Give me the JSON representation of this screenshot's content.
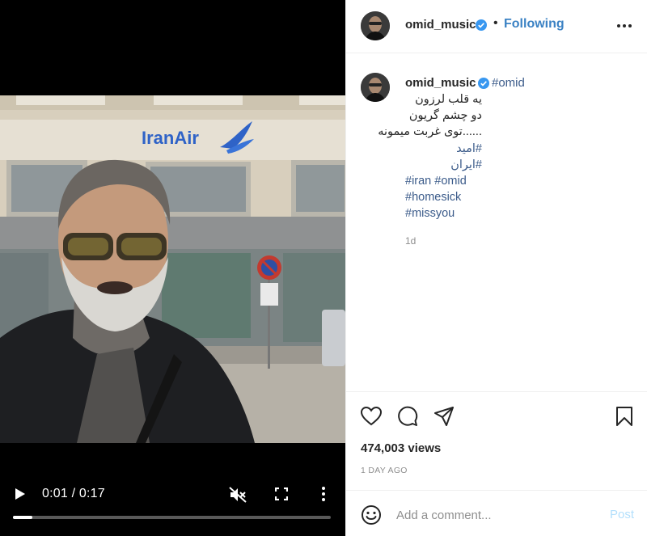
{
  "video": {
    "time_current": "0:01",
    "time_total": "0:17",
    "progress_fraction": 0.06,
    "sign_text": "IranAir"
  },
  "header": {
    "username": "omid_music",
    "separator": "•",
    "follow_status": "Following"
  },
  "caption": {
    "username": "omid_music",
    "first_tag": "#omid",
    "lines": [
      {
        "text": "یه قلب لرزون",
        "type": "rtl"
      },
      {
        "text": "دو چشم گریون",
        "type": "rtl"
      },
      {
        "text": "......توی غربت میمونه",
        "type": "rtl"
      },
      {
        "text": "#امید",
        "type": "rtl-tag"
      },
      {
        "text": "#ایران",
        "type": "rtl-tag"
      },
      {
        "text": "#iran #omid",
        "type": "tag"
      },
      {
        "text": "#homesick",
        "type": "tag"
      },
      {
        "text": "#missyou",
        "type": "tag"
      }
    ],
    "time_ago": "1d"
  },
  "stats": {
    "views": "474,003 views",
    "date": "1 DAY AGO"
  },
  "comment": {
    "placeholder": "Add a comment...",
    "post_label": "Post"
  },
  "icons": {
    "play": "play-icon",
    "mute": "muted-speaker-icon",
    "fullscreen": "fullscreen-icon",
    "menu": "vertical-dots-icon",
    "verified": "verified-badge-icon",
    "more": "horizontal-dots-icon",
    "like": "heart-icon",
    "comment": "comment-bubble-icon",
    "share": "paper-plane-icon",
    "save": "bookmark-icon",
    "emoji": "smiley-icon"
  },
  "colors": {
    "link_blue": "#3b82c4",
    "hashtag": "#3b5b8a",
    "verified": "#3897f0",
    "post_disabled": "#b2dffc",
    "muted_text": "#8e8e8e"
  }
}
